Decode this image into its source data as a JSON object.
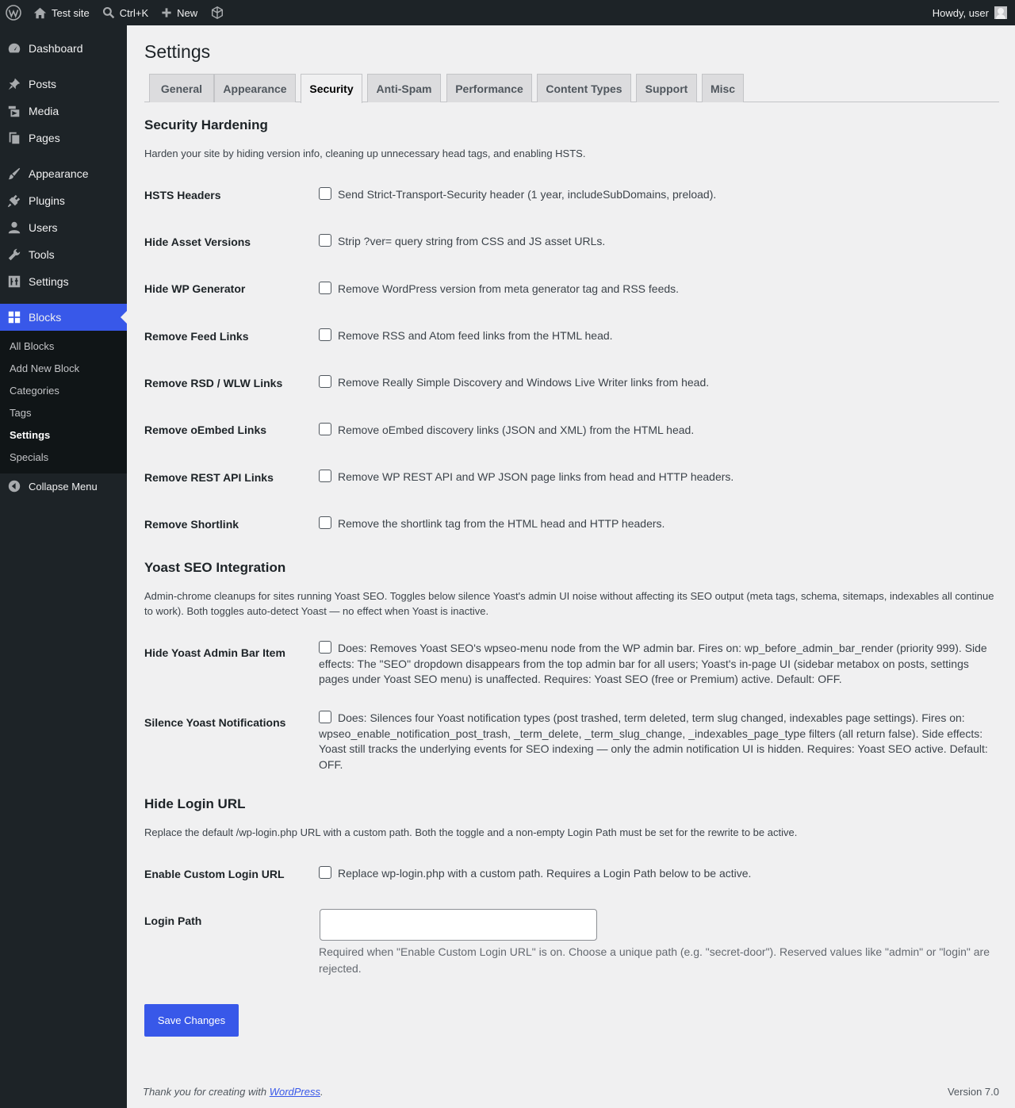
{
  "adminbar": {
    "site_name": "Test site",
    "search_shortcut": "Ctrl+K",
    "new_label": "New",
    "howdy": "Howdy, user"
  },
  "sidebar": {
    "items": [
      {
        "label": "Dashboard",
        "icon": "dashboard-icon"
      },
      {
        "label": "Posts",
        "icon": "pin-icon"
      },
      {
        "label": "Media",
        "icon": "media-icon"
      },
      {
        "label": "Pages",
        "icon": "pages-icon"
      },
      {
        "label": "Appearance",
        "icon": "brush-icon"
      },
      {
        "label": "Plugins",
        "icon": "plug-icon"
      },
      {
        "label": "Users",
        "icon": "user-icon"
      },
      {
        "label": "Tools",
        "icon": "wrench-icon"
      },
      {
        "label": "Settings",
        "icon": "sliders-icon"
      },
      {
        "label": "Blocks",
        "icon": "blocks-icon"
      }
    ],
    "submenu": [
      "All Blocks",
      "Add New Block",
      "Categories",
      "Tags",
      "Settings",
      "Specials"
    ],
    "collapse_label": "Collapse Menu"
  },
  "page": {
    "title": "Settings",
    "tabs": [
      "General",
      "Appearance",
      "Security",
      "Anti-Spam",
      "Performance",
      "Content Types",
      "Support",
      "Misc"
    ],
    "active_tab": "Security"
  },
  "security": {
    "title": "Security Hardening",
    "desc": "Harden your site by hiding version info, cleaning up unnecessary head tags, and enabling HSTS.",
    "rows": [
      {
        "label": "HSTS Headers",
        "text": "Send Strict-Transport-Security header (1 year, includeSubDomains, preload)."
      },
      {
        "label": "Hide Asset Versions",
        "text": "Strip ?ver= query string from CSS and JS asset URLs."
      },
      {
        "label": "Hide WP Generator",
        "text": "Remove WordPress version from meta generator tag and RSS feeds."
      },
      {
        "label": "Remove Feed Links",
        "text": "Remove RSS and Atom feed links from the HTML head."
      },
      {
        "label": "Remove RSD / WLW Links",
        "text": "Remove Really Simple Discovery and Windows Live Writer links from head."
      },
      {
        "label": "Remove oEmbed Links",
        "text": "Remove oEmbed discovery links (JSON and XML) from the HTML head."
      },
      {
        "label": "Remove REST API Links",
        "text": "Remove WP REST API and WP JSON page links from head and HTTP headers."
      },
      {
        "label": "Remove Shortlink",
        "text": "Remove the shortlink tag from the HTML head and HTTP headers."
      }
    ]
  },
  "yoast": {
    "title": "Yoast SEO Integration",
    "desc": "Admin-chrome cleanups for sites running Yoast SEO. Toggles below silence Yoast's admin UI noise without affecting its SEO output (meta tags, schema, sitemaps, indexables all continue to work). Both toggles auto-detect Yoast — no effect when Yoast is inactive.",
    "rows": [
      {
        "label": "Hide Yoast Admin Bar Item",
        "text": "Does: Removes Yoast SEO's wpseo-menu node from the WP admin bar. Fires on: wp_before_admin_bar_render (priority 999). Side effects: The \"SEO\" dropdown disappears from the top admin bar for all users; Yoast's in-page UI (sidebar metabox on posts, settings pages under Yoast SEO menu) is unaffected. Requires: Yoast SEO (free or Premium) active. Default: OFF."
      },
      {
        "label": "Silence Yoast Notifications",
        "text": "Does: Silences four Yoast notification types (post trashed, term deleted, term slug changed, indexables page settings). Fires on: wpseo_enable_notification_post_trash, _term_delete, _term_slug_change, _indexables_page_type filters (all return false). Side effects: Yoast still tracks the underlying events for SEO indexing — only the admin notification UI is hidden. Requires: Yoast SEO active. Default: OFF."
      }
    ]
  },
  "login": {
    "title": "Hide Login URL",
    "desc": "Replace the default /wp-login.php URL with a custom path. Both the toggle and a non-empty Login Path must be set for the rewrite to be active.",
    "enable_label": "Enable Custom Login URL",
    "enable_text": "Replace wp-login.php with a custom path. Requires a Login Path below to be active.",
    "path_label": "Login Path",
    "path_value": "",
    "path_help": "Required when \"Enable Custom Login URL\" is on. Choose a unique path (e.g. \"secret-door\"). Reserved values like \"admin\" or \"login\" are rejected."
  },
  "save_label": "Save Changes",
  "footer": {
    "thanks_prefix": "Thank you for creating with ",
    "thanks_link": "WordPress",
    "thanks_suffix": ".",
    "version": "Version 7.0"
  }
}
